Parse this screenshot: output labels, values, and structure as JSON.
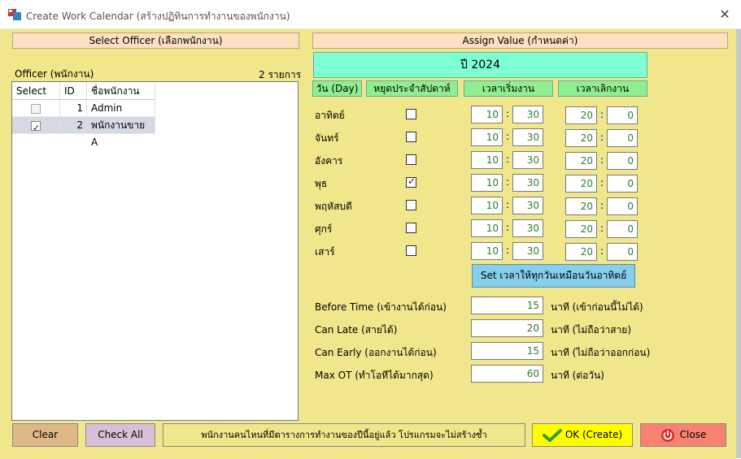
{
  "window": {
    "title": "Create Work Calendar (สร้างปฏิทินการทำงานของพนักงาน)",
    "close_glyph": "✕"
  },
  "left": {
    "header": "Select Officer (เลือกพนักงาน)",
    "officer_label": "Officer (พนักงาน)",
    "count_label": "2 รายการ",
    "columns": [
      "Select",
      "ID",
      "ชื่อพนักงาน"
    ],
    "rows": [
      {
        "checked": false,
        "id": "1",
        "name": "Admin"
      },
      {
        "checked": true,
        "id": "2",
        "name": "พนักงานขาย A"
      }
    ]
  },
  "right": {
    "header": "Assign Value (กำหนดค่า)",
    "year": "ปี 2024",
    "col_day": "วัน (Day)",
    "col_holiday": "หยุดประจำสัปดาห์",
    "col_start": "เวลาเริ่มงาน",
    "col_end": "เวลาเลิกงาน",
    "colon": ":",
    "days": [
      {
        "name": "อาทิตย์",
        "holiday": false,
        "sh": "10",
        "sm": "30",
        "eh": "20",
        "em": "0"
      },
      {
        "name": "จันทร์",
        "holiday": false,
        "sh": "10",
        "sm": "30",
        "eh": "20",
        "em": "0"
      },
      {
        "name": "อังคาร",
        "holiday": false,
        "sh": "10",
        "sm": "30",
        "eh": "20",
        "em": "0"
      },
      {
        "name": "พุธ",
        "holiday": true,
        "sh": "10",
        "sm": "30",
        "eh": "20",
        "em": "0"
      },
      {
        "name": "พฤหัสบดี",
        "holiday": false,
        "sh": "10",
        "sm": "30",
        "eh": "20",
        "em": "0"
      },
      {
        "name": "ศุกร์",
        "holiday": false,
        "sh": "10",
        "sm": "30",
        "eh": "20",
        "em": "0"
      },
      {
        "name": "เสาร์",
        "holiday": false,
        "sh": "10",
        "sm": "30",
        "eh": "20",
        "em": "0"
      }
    ],
    "set_button": "Set เวลาให้ทุกวันเหมือนวันอาทิตย์",
    "settings": [
      {
        "label": "Before Time (เข้างานได้ก่อน)",
        "value": "15",
        "unit": "นาที (เข้าก่อนนี้ไม่ได้)"
      },
      {
        "label": "Can Late (สายได้)",
        "value": "20",
        "unit": "นาที (ไม่ถือว่าสาย)"
      },
      {
        "label": "Can Early (ออกงานได้ก่อน)",
        "value": "15",
        "unit": "นาที (ไม่ถือว่าออกก่อน)"
      },
      {
        "label": "Max OT (ทำโอทีได้มากสุด)",
        "value": "60",
        "unit": "นาที (ต่อวัน)"
      }
    ]
  },
  "footer": {
    "clear": "Clear",
    "check_all": "Check All",
    "message": "พนักงานคนไหนที่มีตารางการทำงานของปีนี้อยู่แล้ว โปรแกรมจะไม่สร้างซ้ำ",
    "ok": "OK (Create)",
    "close": "Close"
  },
  "colors": {
    "form_bg": "#f0e68c",
    "header_bg": "#fde0c0",
    "year_bg": "#7fffd4",
    "colhdr_bg": "#90ee90",
    "set_btn_bg": "#87ceeb",
    "clear_bg": "#deb887",
    "checkall_bg": "#d8bfd8",
    "ok_bg": "#ffff00",
    "close_bg": "#fa8072",
    "value_text": "#2e7d32"
  }
}
